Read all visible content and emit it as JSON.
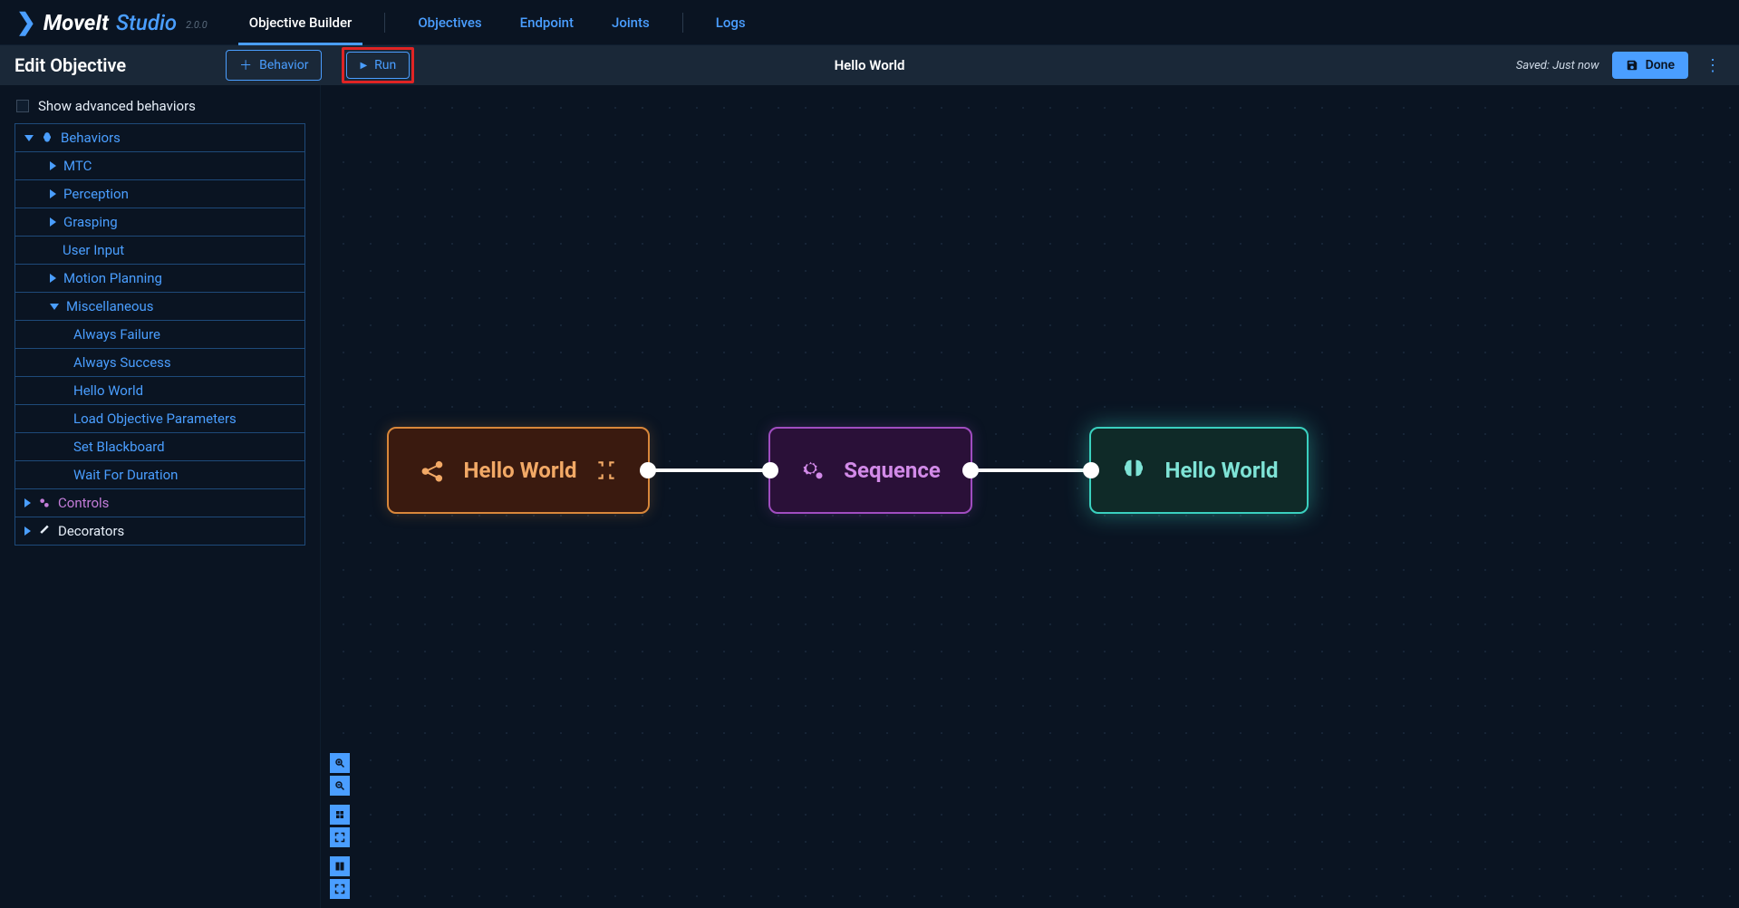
{
  "brand": {
    "m": "MoveIt",
    "s": "Studio",
    "v": "2.0.0"
  },
  "nav": {
    "tabs": [
      "Objective Builder",
      "Objectives",
      "Endpoint",
      "Joints",
      "Logs"
    ],
    "active_index": 0
  },
  "toolbar": {
    "title": "Edit Objective",
    "behavior_btn": "Behavior",
    "run_btn": "Run",
    "center_title": "Hello World",
    "saved_text": "Saved: Just now",
    "done_btn": "Done"
  },
  "sidebar": {
    "advanced_label": "Show advanced behaviors",
    "root_behaviors": "Behaviors",
    "items": {
      "mtc": "MTC",
      "perception": "Perception",
      "grasping": "Grasping",
      "user_input": "User Input",
      "motion_planning": "Motion Planning",
      "misc": "Miscellaneous",
      "misc_children": {
        "always_failure": "Always Failure",
        "always_success": "Always Success",
        "hello_world": "Hello World",
        "load_obj": "Load Objective Parameters",
        "set_blackboard": "Set Blackboard",
        "wait_duration": "Wait For Duration"
      },
      "controls": "Controls",
      "decorators": "Decorators"
    }
  },
  "nodes": {
    "n1": "Hello World",
    "n2": "Sequence",
    "n3": "Hello World"
  },
  "icons": {
    "zoom_in": "zoom-in",
    "zoom_out": "zoom-out",
    "collapse": "collapse",
    "expand": "expand",
    "columns": "columns",
    "fullscreen": "fullscreen"
  }
}
